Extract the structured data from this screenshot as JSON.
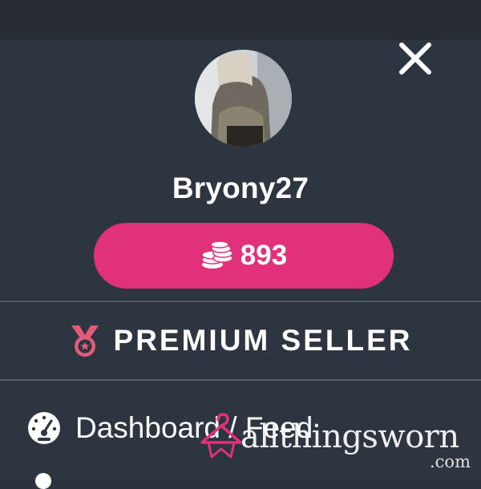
{
  "profile": {
    "username": "Bryony27",
    "coin_balance": "893"
  },
  "badge": {
    "label": "PREMIUM SELLER"
  },
  "menu": {
    "items": [
      {
        "label": "Dashboard / Feed",
        "icon": "gauge-icon"
      }
    ]
  },
  "watermark": {
    "brand": "allthingsworn",
    "tld": ".com"
  },
  "colors": {
    "background": "#2d3540",
    "accent": "#e0317a",
    "medal": "#e25b79"
  }
}
